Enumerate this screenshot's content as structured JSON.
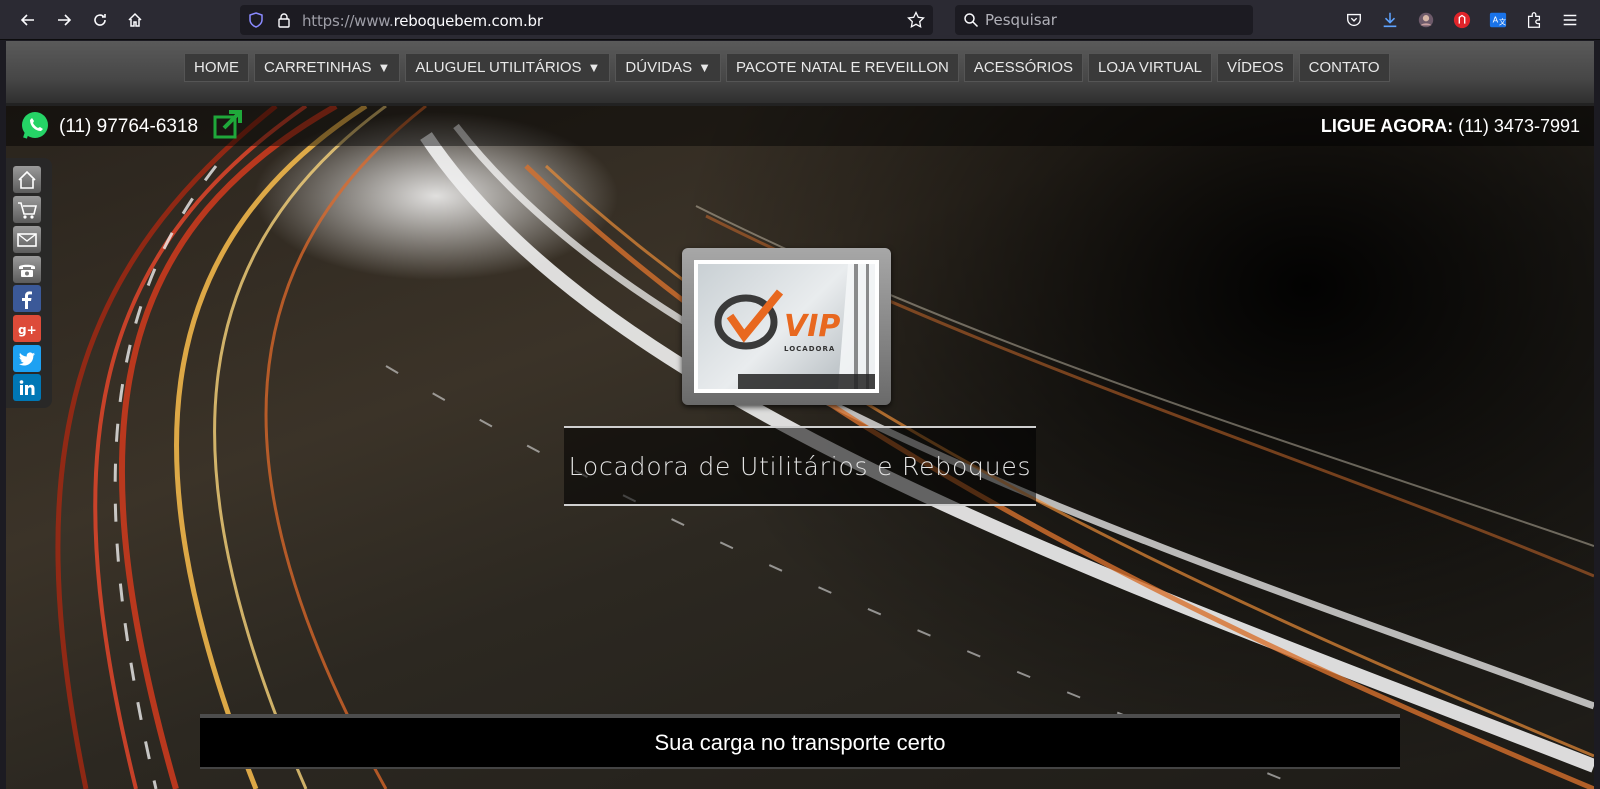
{
  "browser": {
    "url_prefix": "https://www.",
    "url_host": "reboquebem.com.br",
    "search_placeholder": "Pesquisar"
  },
  "menu": {
    "items": [
      {
        "label": "HOME",
        "dropdown": false
      },
      {
        "label": "CARRETINHAS",
        "dropdown": true
      },
      {
        "label": "ALUGUEL UTILITÁRIOS",
        "dropdown": true
      },
      {
        "label": "DÚVIDAS",
        "dropdown": true
      },
      {
        "label": "PACOTE NATAL E REVEILLON",
        "dropdown": false
      },
      {
        "label": "ACESSÓRIOS",
        "dropdown": false
      },
      {
        "label": "LOJA VIRTUAL",
        "dropdown": false
      },
      {
        "label": "VÍDEOS",
        "dropdown": false
      },
      {
        "label": "CONTATO",
        "dropdown": false
      }
    ],
    "caret": "▼"
  },
  "contact": {
    "whatsapp_phone": "(11) 97764-6318",
    "ligue_label": "LIGUE AGORA:",
    "ligue_phone": "(11) 3473-7991"
  },
  "social": [
    {
      "name": "home-icon"
    },
    {
      "name": "cart-icon"
    },
    {
      "name": "mail-icon"
    },
    {
      "name": "phone-icon"
    },
    {
      "name": "facebook-icon",
      "color": "#3b5998"
    },
    {
      "name": "google-plus-icon",
      "color": "#dd4b39"
    },
    {
      "name": "twitter-icon",
      "color": "#1da1f2"
    },
    {
      "name": "linkedin-icon",
      "color": "#0077b5"
    }
  ],
  "logo": {
    "brand": "VIP",
    "sub": "LOCADORA"
  },
  "hero": {
    "tagline": "Locadora de Utilitários e Reboques",
    "slogan": "Sua carga no transporte certo"
  },
  "colors": {
    "whatsapp_green": "#25d366",
    "logo_orange": "#e8681f"
  }
}
